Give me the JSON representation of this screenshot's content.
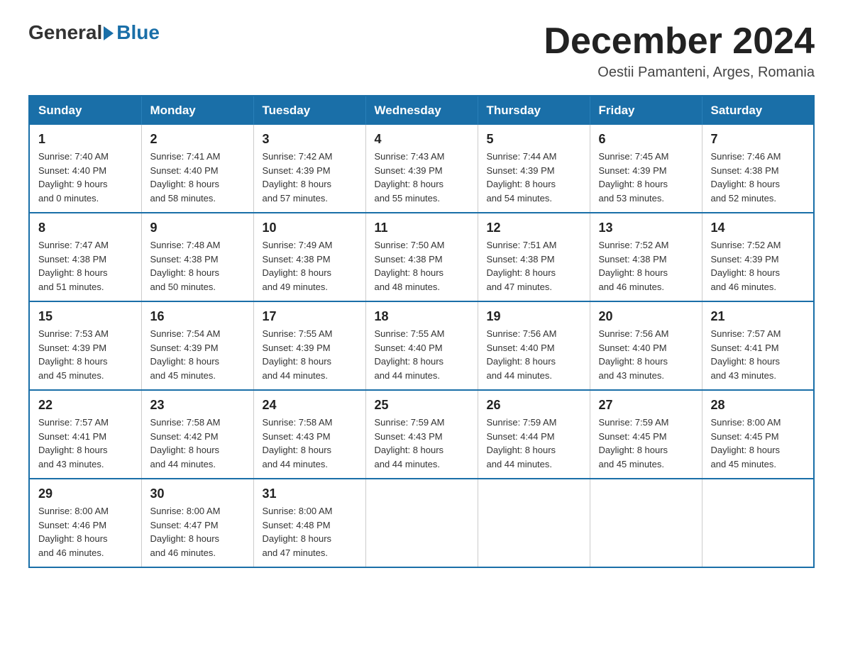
{
  "header": {
    "logo_general": "General",
    "logo_blue": "Blue",
    "title": "December 2024",
    "location": "Oestii Pamanteni, Arges, Romania"
  },
  "days_of_week": [
    "Sunday",
    "Monday",
    "Tuesday",
    "Wednesday",
    "Thursday",
    "Friday",
    "Saturday"
  ],
  "weeks": [
    [
      {
        "day": "1",
        "sunrise": "7:40 AM",
        "sunset": "4:40 PM",
        "daylight": "9 hours and 0 minutes."
      },
      {
        "day": "2",
        "sunrise": "7:41 AM",
        "sunset": "4:40 PM",
        "daylight": "8 hours and 58 minutes."
      },
      {
        "day": "3",
        "sunrise": "7:42 AM",
        "sunset": "4:39 PM",
        "daylight": "8 hours and 57 minutes."
      },
      {
        "day": "4",
        "sunrise": "7:43 AM",
        "sunset": "4:39 PM",
        "daylight": "8 hours and 55 minutes."
      },
      {
        "day": "5",
        "sunrise": "7:44 AM",
        "sunset": "4:39 PM",
        "daylight": "8 hours and 54 minutes."
      },
      {
        "day": "6",
        "sunrise": "7:45 AM",
        "sunset": "4:39 PM",
        "daylight": "8 hours and 53 minutes."
      },
      {
        "day": "7",
        "sunrise": "7:46 AM",
        "sunset": "4:38 PM",
        "daylight": "8 hours and 52 minutes."
      }
    ],
    [
      {
        "day": "8",
        "sunrise": "7:47 AM",
        "sunset": "4:38 PM",
        "daylight": "8 hours and 51 minutes."
      },
      {
        "day": "9",
        "sunrise": "7:48 AM",
        "sunset": "4:38 PM",
        "daylight": "8 hours and 50 minutes."
      },
      {
        "day": "10",
        "sunrise": "7:49 AM",
        "sunset": "4:38 PM",
        "daylight": "8 hours and 49 minutes."
      },
      {
        "day": "11",
        "sunrise": "7:50 AM",
        "sunset": "4:38 PM",
        "daylight": "8 hours and 48 minutes."
      },
      {
        "day": "12",
        "sunrise": "7:51 AM",
        "sunset": "4:38 PM",
        "daylight": "8 hours and 47 minutes."
      },
      {
        "day": "13",
        "sunrise": "7:52 AM",
        "sunset": "4:38 PM",
        "daylight": "8 hours and 46 minutes."
      },
      {
        "day": "14",
        "sunrise": "7:52 AM",
        "sunset": "4:39 PM",
        "daylight": "8 hours and 46 minutes."
      }
    ],
    [
      {
        "day": "15",
        "sunrise": "7:53 AM",
        "sunset": "4:39 PM",
        "daylight": "8 hours and 45 minutes."
      },
      {
        "day": "16",
        "sunrise": "7:54 AM",
        "sunset": "4:39 PM",
        "daylight": "8 hours and 45 minutes."
      },
      {
        "day": "17",
        "sunrise": "7:55 AM",
        "sunset": "4:39 PM",
        "daylight": "8 hours and 44 minutes."
      },
      {
        "day": "18",
        "sunrise": "7:55 AM",
        "sunset": "4:40 PM",
        "daylight": "8 hours and 44 minutes."
      },
      {
        "day": "19",
        "sunrise": "7:56 AM",
        "sunset": "4:40 PM",
        "daylight": "8 hours and 44 minutes."
      },
      {
        "day": "20",
        "sunrise": "7:56 AM",
        "sunset": "4:40 PM",
        "daylight": "8 hours and 43 minutes."
      },
      {
        "day": "21",
        "sunrise": "7:57 AM",
        "sunset": "4:41 PM",
        "daylight": "8 hours and 43 minutes."
      }
    ],
    [
      {
        "day": "22",
        "sunrise": "7:57 AM",
        "sunset": "4:41 PM",
        "daylight": "8 hours and 43 minutes."
      },
      {
        "day": "23",
        "sunrise": "7:58 AM",
        "sunset": "4:42 PM",
        "daylight": "8 hours and 44 minutes."
      },
      {
        "day": "24",
        "sunrise": "7:58 AM",
        "sunset": "4:43 PM",
        "daylight": "8 hours and 44 minutes."
      },
      {
        "day": "25",
        "sunrise": "7:59 AM",
        "sunset": "4:43 PM",
        "daylight": "8 hours and 44 minutes."
      },
      {
        "day": "26",
        "sunrise": "7:59 AM",
        "sunset": "4:44 PM",
        "daylight": "8 hours and 44 minutes."
      },
      {
        "day": "27",
        "sunrise": "7:59 AM",
        "sunset": "4:45 PM",
        "daylight": "8 hours and 45 minutes."
      },
      {
        "day": "28",
        "sunrise": "8:00 AM",
        "sunset": "4:45 PM",
        "daylight": "8 hours and 45 minutes."
      }
    ],
    [
      {
        "day": "29",
        "sunrise": "8:00 AM",
        "sunset": "4:46 PM",
        "daylight": "8 hours and 46 minutes."
      },
      {
        "day": "30",
        "sunrise": "8:00 AM",
        "sunset": "4:47 PM",
        "daylight": "8 hours and 46 minutes."
      },
      {
        "day": "31",
        "sunrise": "8:00 AM",
        "sunset": "4:48 PM",
        "daylight": "8 hours and 47 minutes."
      },
      null,
      null,
      null,
      null
    ]
  ],
  "labels": {
    "sunrise": "Sunrise:",
    "sunset": "Sunset:",
    "daylight": "Daylight:"
  }
}
